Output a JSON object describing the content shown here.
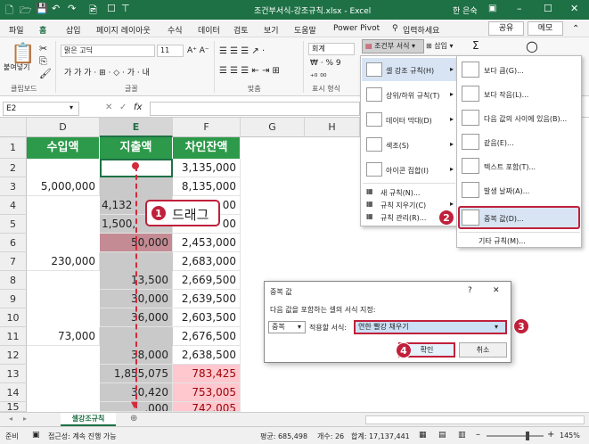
{
  "titlebar": {
    "title": "조건부서식-강조규칙.xlsx - Excel",
    "user": "한 은숙",
    "quick_access": [
      "🗋",
      "🗁",
      "💾",
      "↶",
      "↷",
      "🖻",
      "☐",
      "⊤"
    ]
  },
  "menu": {
    "items": [
      "파일",
      "홈",
      "삽입",
      "페이지 레이아웃",
      "수식",
      "데이터",
      "검토",
      "보기",
      "도움말",
      "Power Pivot"
    ],
    "tell_me": "입력하세요",
    "share": "공유",
    "memo": "메모"
  },
  "ribbon": {
    "paste": "붙여넣기",
    "font_name": "맑은 고딕",
    "font_size": "11",
    "number_format": "회계",
    "groups": [
      "클립보드",
      "글꼴",
      "맞춤",
      "표시 형식"
    ],
    "cond_format": "조건부 서식",
    "insert": "삽입",
    "sum_icon": "Σ"
  },
  "formula_bar": {
    "name_box": "E2",
    "fx": "fx"
  },
  "columns": [
    "D",
    "E",
    "F",
    "G",
    "H",
    "I",
    "J"
  ],
  "rows": [
    "1",
    "2",
    "3",
    "4",
    "5",
    "6",
    "7",
    "8",
    "9",
    "10",
    "11",
    "12",
    "13",
    "14",
    "15"
  ],
  "headers": {
    "d": "수입액",
    "e": "지출액",
    "f": "차인잔액"
  },
  "cells": {
    "d": [
      "",
      "5,000,000",
      "",
      "",
      "",
      "230,000",
      "",
      "",
      "",
      "73,000",
      "",
      "",
      "",
      ""
    ],
    "e": [
      "",
      "",
      "4,132",
      "1,500,",
      "50,000",
      "",
      "13,500",
      "30,000",
      "36,000",
      "",
      "38,000",
      "1,855,075",
      "30,420",
      ",000"
    ],
    "f": [
      "3,135,000",
      "8,135,000",
      "00",
      "00",
      "2,453,000",
      "2,683,000",
      "2,669,500",
      "2,639,500",
      "2,603,500",
      "2,676,500",
      "2,638,500",
      "783,425",
      "753,005",
      "742,005"
    ]
  },
  "drag": {
    "badge": "1",
    "label": "드래그"
  },
  "menu1": {
    "items": [
      "셀 강조 규칙(H)",
      "상위/하위 규칙(T)",
      "데이터 막대(D)",
      "색조(S)",
      "아이콘 집합(I)",
      "새 규칙(N)...",
      "규칙 지우기(C)",
      "규칙 관리(R)..."
    ]
  },
  "menu2": {
    "items": [
      "보다 큼(G)...",
      "보다 작음(L)...",
      "다음 값의 사이에 있음(B)...",
      "같음(E)...",
      "텍스트 포함(T)...",
      "발생 날짜(A)...",
      "중복 값(D)...",
      "기타 규칙(M)..."
    ],
    "badge": "2"
  },
  "dialog": {
    "title": "중복 값",
    "help": "?",
    "close": "✕",
    "prompt": "다음 값을 포함하는 셀의 서식 지정:",
    "type_value": "중복",
    "apply_label": "적용할 서식:",
    "format_value": "연한 빨강 채우기",
    "ok": "확인",
    "cancel": "취소",
    "badge_format": "3",
    "badge_ok": "4"
  },
  "sheet_tab": {
    "name": "셀강조규칙",
    "add": "⊕"
  },
  "status": {
    "ready": "준비",
    "accessibility": "접근성: 계속 진행 가능",
    "average": "평균: 685,498",
    "count": "개수: 26",
    "sum": "합계: 17,137,441",
    "zoom": "145%"
  },
  "colors": {
    "excel_green": "#1e7145",
    "header_green": "#2c9a4a",
    "dup_fill": "#ffc7ce",
    "dup_text": "#9c0006",
    "badge_red": "#c0203b",
    "selection": "#c9c9c9",
    "highlight_item": "#d8e4f4"
  }
}
